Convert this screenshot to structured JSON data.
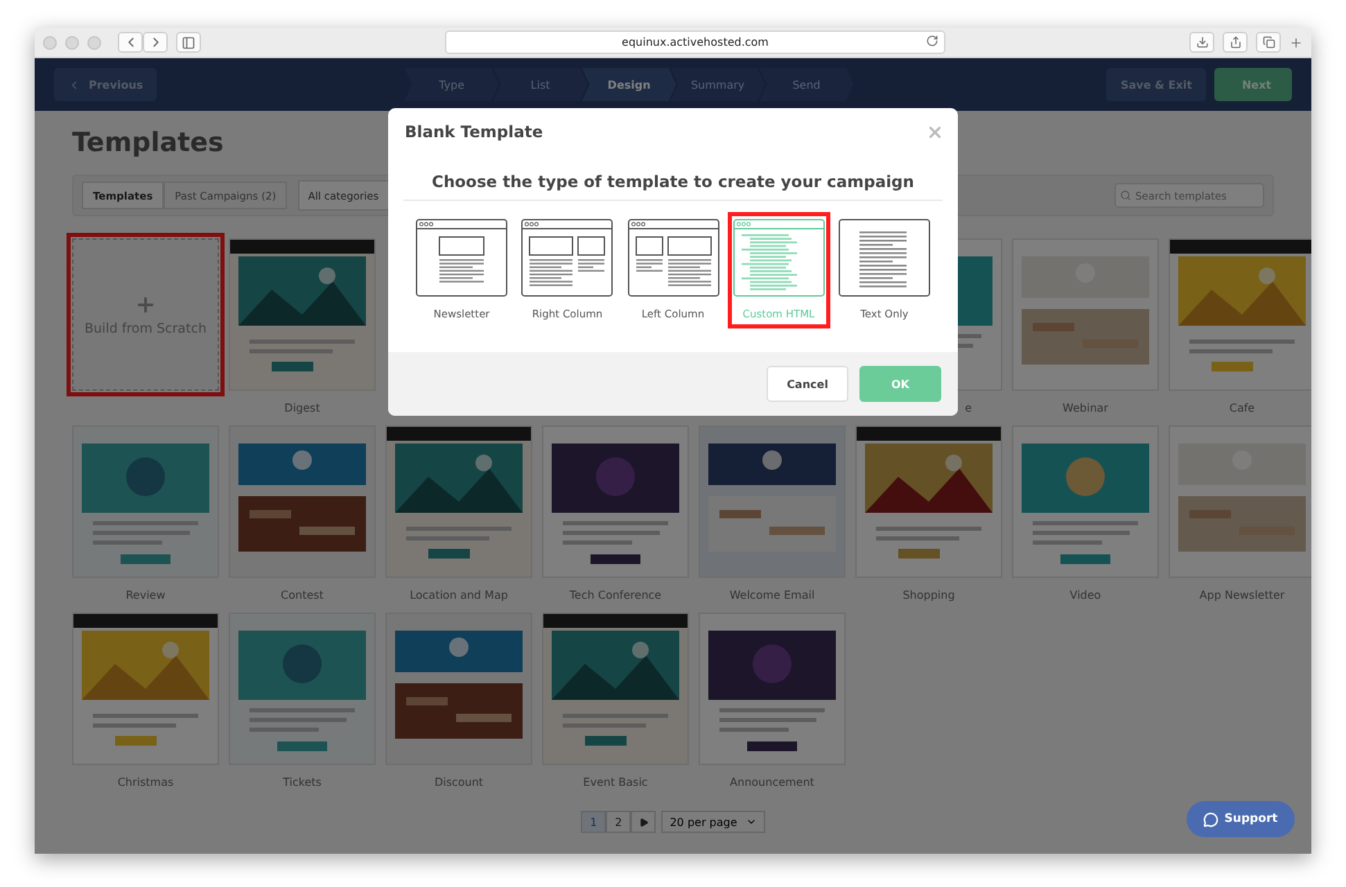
{
  "browser": {
    "url": "equinux.activehosted.com"
  },
  "nav": {
    "previous": "Previous",
    "steps": [
      {
        "label": "Type",
        "selected": false
      },
      {
        "label": "List",
        "selected": false
      },
      {
        "label": "Design",
        "selected": true
      },
      {
        "label": "Summary",
        "selected": false
      },
      {
        "label": "Send",
        "selected": false
      }
    ],
    "save": "Save & Exit",
    "next": "Next"
  },
  "page": {
    "title": "Templates",
    "tabs": [
      {
        "label": "Templates",
        "selected": true
      },
      {
        "label": "Past Campaigns (2)",
        "selected": false
      }
    ],
    "category": "All categories",
    "search": {
      "placeholder": "Search templates"
    }
  },
  "templates": [
    {
      "kind": "scratch",
      "label": "Build from Scratch",
      "highlighted": true
    },
    {
      "kind": "picture",
      "label": "Digest"
    },
    {
      "kind": "covered"
    },
    {
      "kind": "covered"
    },
    {
      "kind": "covered"
    },
    {
      "kind": "picture",
      "label": "e",
      "label_cut": true
    },
    {
      "kind": "picture",
      "label": "Webinar"
    },
    {
      "kind": "picture",
      "label": "Cafe"
    },
    {
      "kind": "picture",
      "label": "Review"
    },
    {
      "kind": "picture",
      "label": "Contest"
    },
    {
      "kind": "picture",
      "label": "Location and Map"
    },
    {
      "kind": "picture",
      "label": "Tech Conference"
    },
    {
      "kind": "picture",
      "label": "Welcome Email"
    },
    {
      "kind": "picture",
      "label": "Shopping"
    },
    {
      "kind": "picture",
      "label": "Video"
    },
    {
      "kind": "picture",
      "label": "App Newsletter"
    },
    {
      "kind": "picture",
      "label": "Christmas"
    },
    {
      "kind": "picture",
      "label": "Tickets"
    },
    {
      "kind": "picture",
      "label": "Discount"
    },
    {
      "kind": "picture",
      "label": "Event Basic"
    },
    {
      "kind": "picture",
      "label": "Announcement"
    }
  ],
  "pagination": {
    "pages": [
      {
        "label": "1",
        "selected": true
      },
      {
        "label": "2",
        "selected": false
      }
    ],
    "per_page": "20 per page"
  },
  "support": "Support",
  "modal": {
    "title": "Blank Template",
    "subtitle": "Choose the type of template to create your campaign",
    "options": [
      {
        "kind": "newsletter",
        "label": "Newsletter",
        "selected": false,
        "highlighted": false
      },
      {
        "kind": "right-column",
        "label": "Right Column",
        "selected": false,
        "highlighted": false
      },
      {
        "kind": "left-column",
        "label": "Left Column",
        "selected": false,
        "highlighted": false
      },
      {
        "kind": "custom-html",
        "label": "Custom HTML",
        "selected": true,
        "highlighted": true
      },
      {
        "kind": "text-only",
        "label": "Text Only",
        "selected": false,
        "highlighted": false
      }
    ],
    "cancel": "Cancel",
    "ok": "OK"
  }
}
